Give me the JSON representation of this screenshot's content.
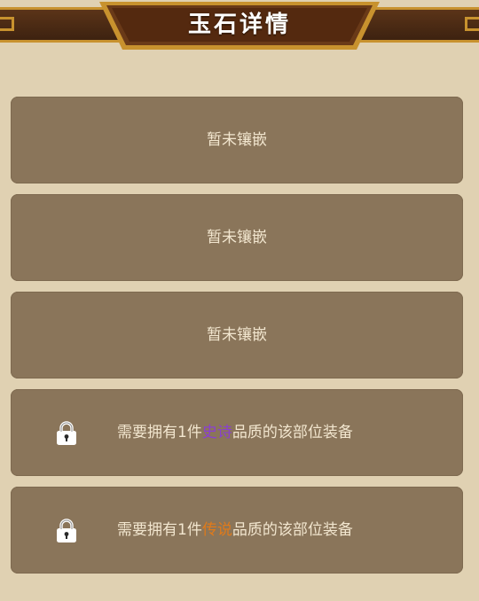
{
  "header": {
    "title": "玉石详情"
  },
  "slots": [
    {
      "status": "暂未镶嵌"
    },
    {
      "status": "暂未镶嵌"
    },
    {
      "status": "暂未镶嵌"
    }
  ],
  "locked_slots": [
    {
      "icon": "lock-icon",
      "prefix": "需要拥有1件",
      "quality": "史诗",
      "quality_color": "#8a3fd1",
      "suffix": "品质的该部位装备"
    },
    {
      "icon": "lock-icon",
      "prefix": "需要拥有1件",
      "quality": "传说",
      "quality_color": "#e07a1a",
      "suffix": "品质的该部位装备"
    }
  ]
}
